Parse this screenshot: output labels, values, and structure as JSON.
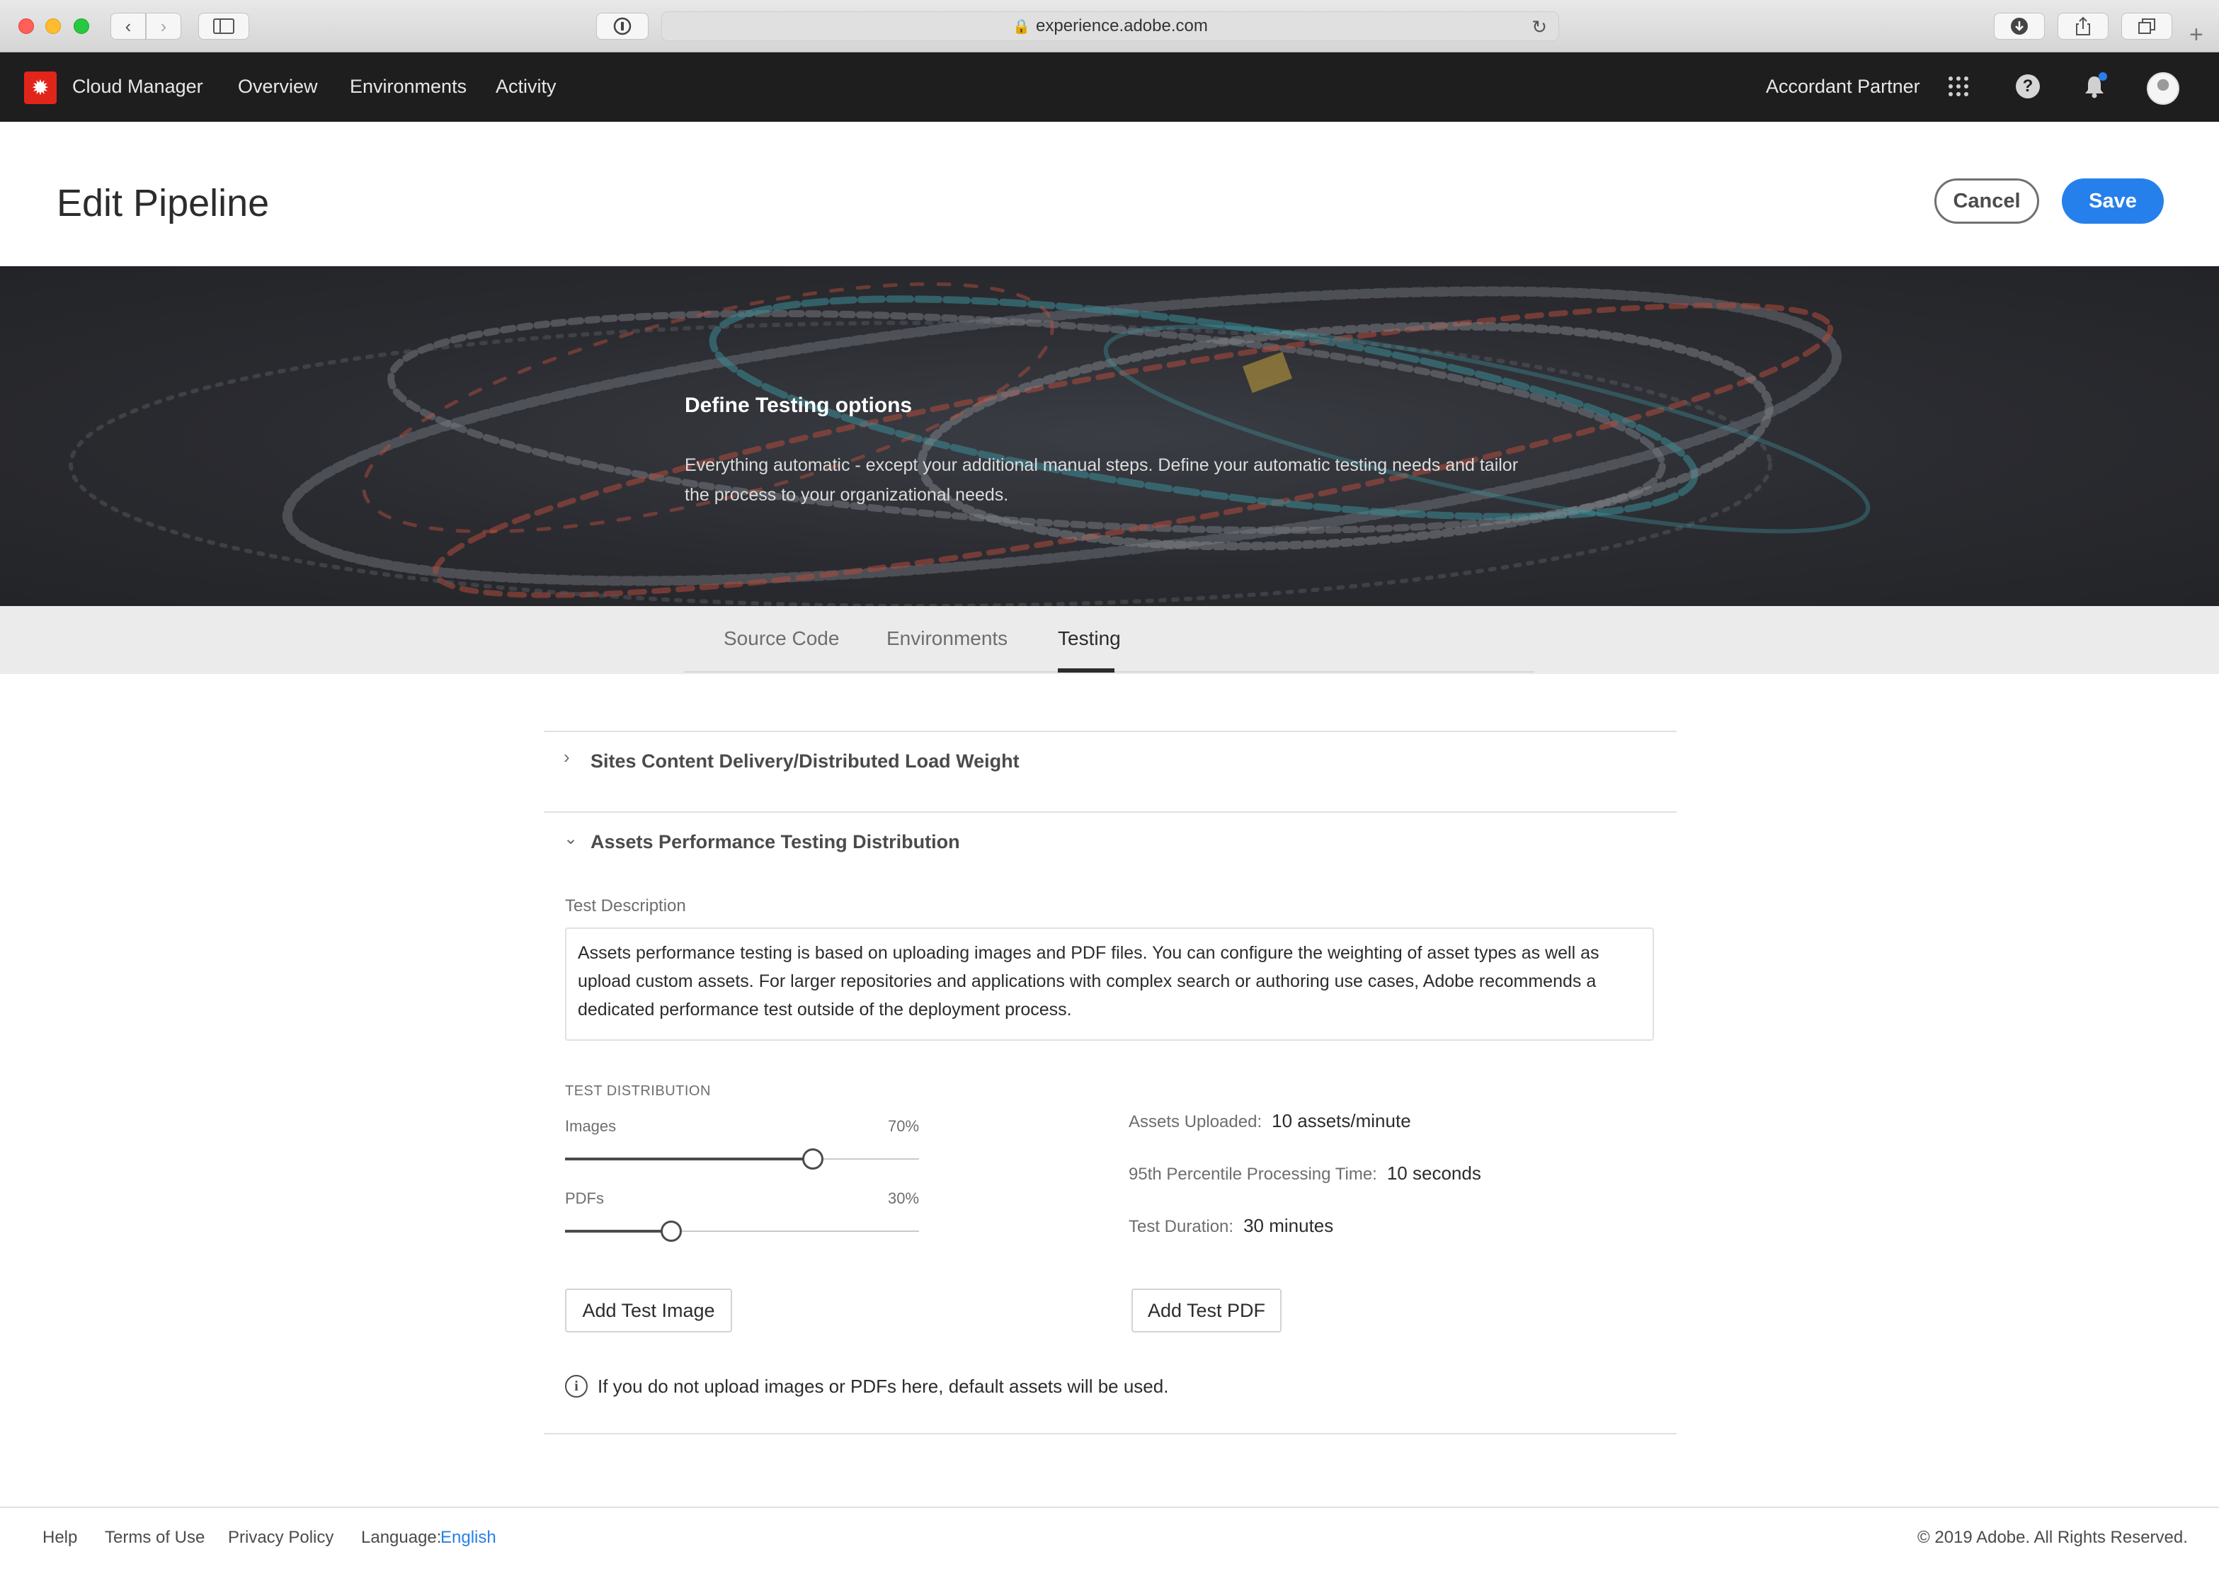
{
  "browser": {
    "url": "experience.adobe.com"
  },
  "app": {
    "name": "Cloud Manager",
    "nav": [
      "Overview",
      "Environments",
      "Activity"
    ],
    "org": "Accordant Partner"
  },
  "header": {
    "title": "Edit Pipeline",
    "cancel_label": "Cancel",
    "save_label": "Save"
  },
  "hero": {
    "title": "Define Testing options",
    "description": "Everything automatic - except your additional manual steps. Define your automatic testing needs and tailor the process to your organizational needs."
  },
  "tabs": [
    {
      "label": "Source Code",
      "active": false
    },
    {
      "label": "Environments",
      "active": false
    },
    {
      "label": "Testing",
      "active": true
    }
  ],
  "sections": {
    "sites": {
      "title": "Sites Content Delivery/Distributed Load Weight",
      "expanded": false
    },
    "assets": {
      "title": "Assets Performance Testing Distribution",
      "expanded": true,
      "test_description_label": "Test Description",
      "test_description": "Assets performance testing is based on uploading images and PDF files. You can configure the weighting of asset types as well as upload custom assets. For larger repositories and applications with complex search or authoring use cases, Adobe recommends a dedicated performance test outside of the deployment process.",
      "distribution_label": "TEST DISTRIBUTION",
      "sliders": [
        {
          "label": "Images",
          "value_text": "70%",
          "value": 70
        },
        {
          "label": "PDFs",
          "value_text": "30%",
          "value": 30
        }
      ],
      "stats": [
        {
          "label": "Assets Uploaded:",
          "value": "10 assets/minute"
        },
        {
          "label": "95th Percentile Processing Time:",
          "value": "10 seconds"
        },
        {
          "label": "Test Duration:",
          "value": "30 minutes"
        }
      ],
      "add_image_label": "Add Test Image",
      "add_pdf_label": "Add Test PDF",
      "info_text": "If you do not upload images or PDFs here, default assets will be used."
    }
  },
  "footer": {
    "links": [
      "Help",
      "Terms of Use",
      "Privacy Policy"
    ],
    "language_label": "Language:",
    "language_value": "English",
    "copyright": "© 2019 Adobe. All Rights Reserved."
  },
  "icons": {
    "back": "chevron-left-icon",
    "forward": "chevron-right-icon",
    "sidebar": "sidebar-icon",
    "password": "password-icon",
    "lock": "lock-icon",
    "reload": "reload-icon",
    "download": "download-icon",
    "share": "share-icon",
    "tabs": "tabs-icon",
    "apps": "apps-grid-icon",
    "help": "help-icon",
    "bell": "bell-icon",
    "info": "info-icon"
  },
  "colors": {
    "accent": "#2680eb",
    "brand": "#e1251b",
    "topnav_bg": "#1e1e1e"
  }
}
